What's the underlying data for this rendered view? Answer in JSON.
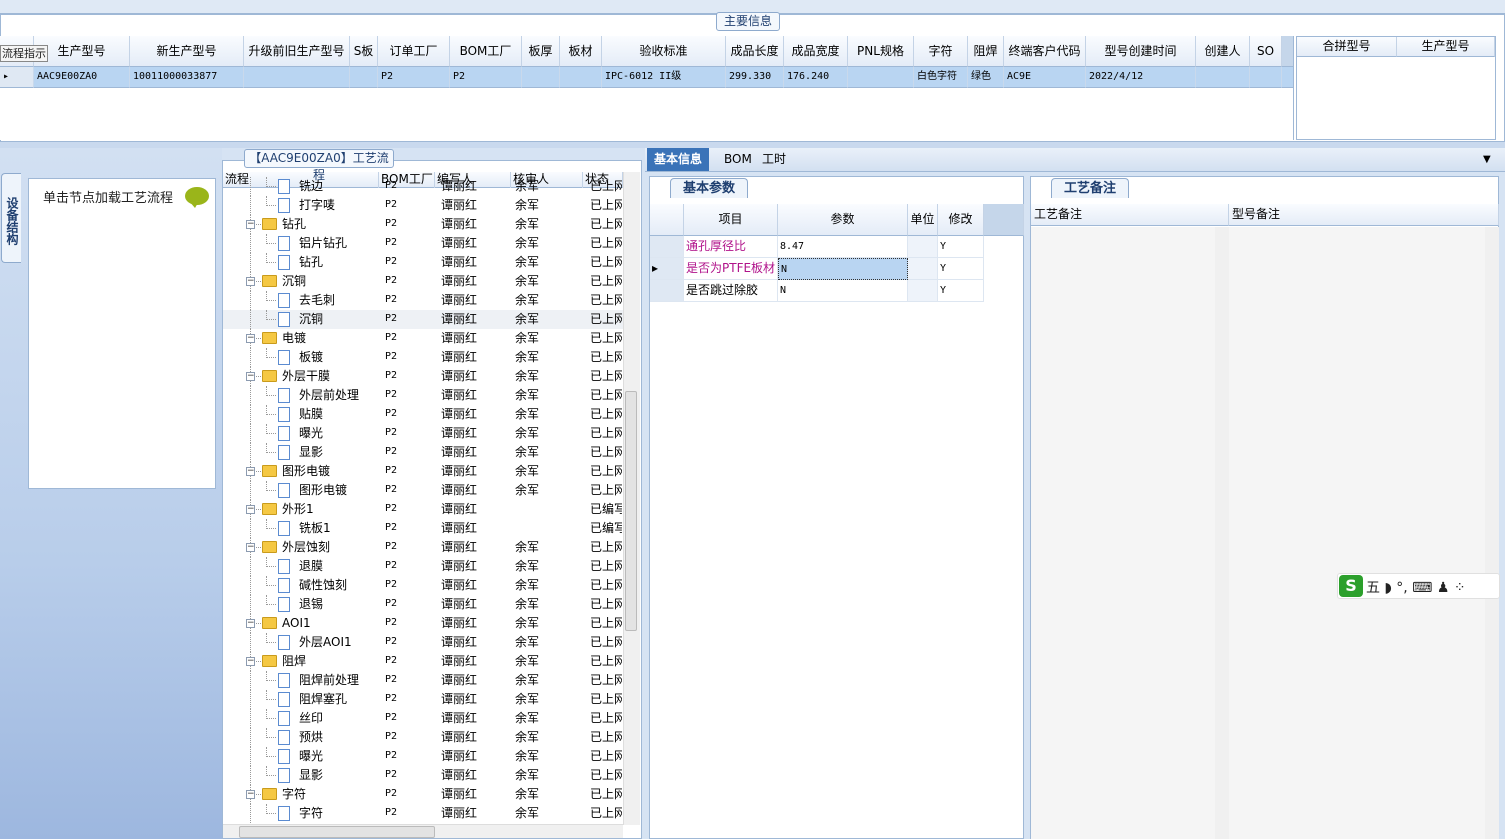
{
  "main_info": {
    "title": "主要信息",
    "flow_hint": "流程指示",
    "columns": [
      "生产型号",
      "新生产型号",
      "升级前旧生产型号",
      "S板",
      "订单工厂",
      "BOM工厂",
      "板厚",
      "板材",
      "验收标准",
      "成品长度",
      "成品宽度",
      "PNL规格",
      "字符",
      "阻焊",
      "终端客户代码",
      "型号创建时间",
      "创建人",
      "SO"
    ],
    "row": {
      "生产型号": "AAC9E00ZA0",
      "新生产型号": "10011000033877",
      "升级前旧生产型号": "",
      "S板": "",
      "订单工厂": "P2",
      "BOM工厂": "P2",
      "板厚": "",
      "板材": "",
      "验收标准": "IPC-6012 II级",
      "成品长度": "299.330",
      "成品宽度": "176.240",
      "PNL规格": "",
      "字符": "白色字符",
      "阻焊": "绿色",
      "终端客户代码": "AC9E",
      "型号创建时间": "2022/4/12",
      "创建人": "",
      "SO": ""
    },
    "merge_columns": [
      "合拼型号",
      "生产型号"
    ]
  },
  "left_panel": {
    "side_tab": "设备结构",
    "click_hint": "单击节点加载工艺流程"
  },
  "flow": {
    "title": "【AAC9E00ZA0】工艺流程",
    "columns": [
      "流程",
      "BOM工厂",
      "编写人",
      "核审人",
      "状态"
    ],
    "rows": [
      {
        "level": 2,
        "name": "铣边",
        "factory": "P2",
        "writer": "谭丽红",
        "reviewer": "余军",
        "status": "已上网"
      },
      {
        "level": 2,
        "name": "打字唛",
        "factory": "P2",
        "writer": "谭丽红",
        "reviewer": "余军",
        "status": "已上网"
      },
      {
        "level": 1,
        "name": "钻孔",
        "factory": "P2",
        "writer": "谭丽红",
        "reviewer": "余军",
        "status": "已上网"
      },
      {
        "level": 2,
        "name": "铝片钻孔",
        "factory": "P2",
        "writer": "谭丽红",
        "reviewer": "余军",
        "status": "已上网"
      },
      {
        "level": 2,
        "name": "钻孔",
        "factory": "P2",
        "writer": "谭丽红",
        "reviewer": "余军",
        "status": "已上网"
      },
      {
        "level": 1,
        "name": "沉铜",
        "factory": "P2",
        "writer": "谭丽红",
        "reviewer": "余军",
        "status": "已上网"
      },
      {
        "level": 2,
        "name": "去毛刺",
        "factory": "P2",
        "writer": "谭丽红",
        "reviewer": "余军",
        "status": "已上网"
      },
      {
        "level": 2,
        "name": "沉铜",
        "factory": "P2",
        "writer": "谭丽红",
        "reviewer": "余军",
        "status": "已上网",
        "selected": true
      },
      {
        "level": 1,
        "name": "电镀",
        "factory": "P2",
        "writer": "谭丽红",
        "reviewer": "余军",
        "status": "已上网"
      },
      {
        "level": 2,
        "name": "板镀",
        "factory": "P2",
        "writer": "谭丽红",
        "reviewer": "余军",
        "status": "已上网"
      },
      {
        "level": 1,
        "name": "外层干膜",
        "factory": "P2",
        "writer": "谭丽红",
        "reviewer": "余军",
        "status": "已上网"
      },
      {
        "level": 2,
        "name": "外层前处理",
        "factory": "P2",
        "writer": "谭丽红",
        "reviewer": "余军",
        "status": "已上网"
      },
      {
        "level": 2,
        "name": "贴膜",
        "factory": "P2",
        "writer": "谭丽红",
        "reviewer": "余军",
        "status": "已上网"
      },
      {
        "level": 2,
        "name": "曝光",
        "factory": "P2",
        "writer": "谭丽红",
        "reviewer": "余军",
        "status": "已上网"
      },
      {
        "level": 2,
        "name": "显影",
        "factory": "P2",
        "writer": "谭丽红",
        "reviewer": "余军",
        "status": "已上网"
      },
      {
        "level": 1,
        "name": "图形电镀",
        "factory": "P2",
        "writer": "谭丽红",
        "reviewer": "余军",
        "status": "已上网"
      },
      {
        "level": 2,
        "name": "图形电镀",
        "factory": "P2",
        "writer": "谭丽红",
        "reviewer": "余军",
        "status": "已上网"
      },
      {
        "level": 1,
        "name": "外形1",
        "factory": "P2",
        "writer": "谭丽红",
        "reviewer": "",
        "status": "已编写"
      },
      {
        "level": 2,
        "name": "铣板1",
        "factory": "P2",
        "writer": "谭丽红",
        "reviewer": "",
        "status": "已编写"
      },
      {
        "level": 1,
        "name": "外层蚀刻",
        "factory": "P2",
        "writer": "谭丽红",
        "reviewer": "余军",
        "status": "已上网"
      },
      {
        "level": 2,
        "name": "退膜",
        "factory": "P2",
        "writer": "谭丽红",
        "reviewer": "余军",
        "status": "已上网"
      },
      {
        "level": 2,
        "name": "碱性蚀刻",
        "factory": "P2",
        "writer": "谭丽红",
        "reviewer": "余军",
        "status": "已上网"
      },
      {
        "level": 2,
        "name": "退锡",
        "factory": "P2",
        "writer": "谭丽红",
        "reviewer": "余军",
        "status": "已上网"
      },
      {
        "level": 1,
        "name": "AOI1",
        "factory": "P2",
        "writer": "谭丽红",
        "reviewer": "余军",
        "status": "已上网"
      },
      {
        "level": 2,
        "name": "外层AOI1",
        "factory": "P2",
        "writer": "谭丽红",
        "reviewer": "余军",
        "status": "已上网"
      },
      {
        "level": 1,
        "name": "阻焊",
        "factory": "P2",
        "writer": "谭丽红",
        "reviewer": "余军",
        "status": "已上网"
      },
      {
        "level": 2,
        "name": "阻焊前处理",
        "factory": "P2",
        "writer": "谭丽红",
        "reviewer": "余军",
        "status": "已上网"
      },
      {
        "level": 2,
        "name": "阻焊塞孔",
        "factory": "P2",
        "writer": "谭丽红",
        "reviewer": "余军",
        "status": "已上网"
      },
      {
        "level": 2,
        "name": "丝印",
        "factory": "P2",
        "writer": "谭丽红",
        "reviewer": "余军",
        "status": "已上网"
      },
      {
        "level": 2,
        "name": "预烘",
        "factory": "P2",
        "writer": "谭丽红",
        "reviewer": "余军",
        "status": "已上网"
      },
      {
        "level": 2,
        "name": "曝光",
        "factory": "P2",
        "writer": "谭丽红",
        "reviewer": "余军",
        "status": "已上网"
      },
      {
        "level": 2,
        "name": "显影",
        "factory": "P2",
        "writer": "谭丽红",
        "reviewer": "余军",
        "status": "已上网"
      },
      {
        "level": 1,
        "name": "字符",
        "factory": "P2",
        "writer": "谭丽红",
        "reviewer": "余军",
        "status": "已上网"
      },
      {
        "level": 2,
        "name": "字符",
        "factory": "P2",
        "writer": "谭丽红",
        "reviewer": "余军",
        "status": "已上网"
      }
    ]
  },
  "tabs": [
    "基本信息",
    "BOM",
    "工时"
  ],
  "basic_params": {
    "title": "基本参数",
    "columns": [
      "项目",
      "参数",
      "单位",
      "修改"
    ],
    "rows": [
      {
        "item": "通孔厚径比",
        "value": "8.47",
        "unit": "",
        "modify": "Y",
        "highlight": true
      },
      {
        "item": "是否为PTFE板材",
        "value": "N",
        "unit": "",
        "modify": "Y",
        "highlight": true,
        "current": true
      },
      {
        "item": "是否跳过除胶",
        "value": "N",
        "unit": "",
        "modify": "Y",
        "highlight": false
      }
    ]
  },
  "notes": {
    "title": "工艺备注",
    "col1": "工艺备注",
    "col2": "型号备注"
  },
  "ime": {
    "logo": "S",
    "text": "五 ◗ °, ⌨ ♟ ⁘"
  },
  "colors": {
    "selected_row": "#b9d5f2",
    "tab_active": "#3a73b8",
    "highlight_text": "#b0128a"
  }
}
